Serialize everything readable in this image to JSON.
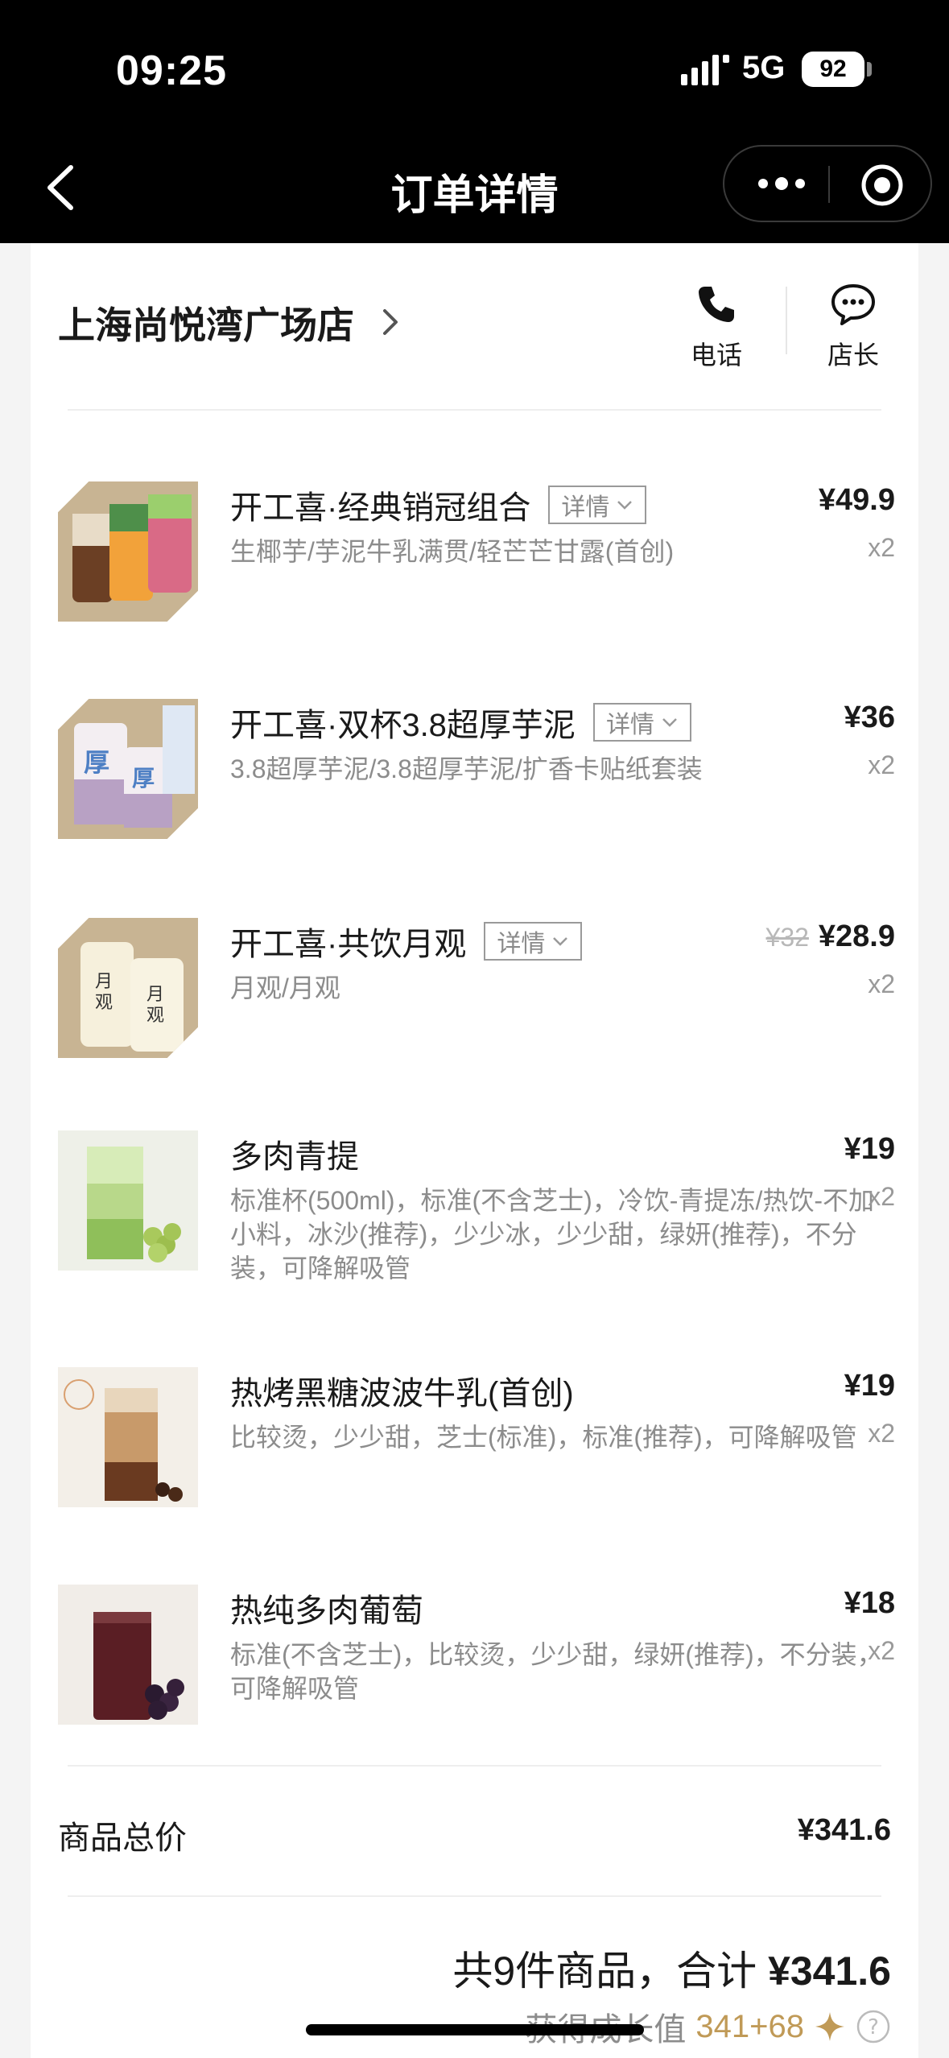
{
  "status_bar": {
    "time": "09:25",
    "network": "5G",
    "battery": "92"
  },
  "nav": {
    "title": "订单详情"
  },
  "store": {
    "name": "上海尚悦湾广场店",
    "phone_label": "电话",
    "manager_label": "店长"
  },
  "items": [
    {
      "name": "开工喜·经典销冠组合",
      "detail": "详情",
      "desc": "生椰芋/芋泥牛乳满贯/轻芒芒甘露(首创)",
      "price": "¥49.9",
      "qty": "x2"
    },
    {
      "name": "开工喜·双杯3.8超厚芋泥",
      "detail": "详情",
      "desc": "3.8超厚芋泥/3.8超厚芋泥/扩香卡贴纸套装",
      "price": "¥36",
      "qty": "x2"
    },
    {
      "name": "开工喜·共饮月观",
      "detail": "详情",
      "desc": "月观/月观",
      "old_price": "¥32",
      "price": "¥28.9",
      "qty": "x2"
    },
    {
      "name": "多肉青提",
      "desc": "标准杯(500ml)，标准(不含芝士)，冷饮-青提冻/热饮-不加小料，冰沙(推荐)，少少冰，少少甜，绿妍(推荐)，不分装，可降解吸管",
      "price": "¥19",
      "qty": "x2"
    },
    {
      "name": "热烤黑糖波波牛乳(首创)",
      "desc": "比较烫，少少甜，芝士(标准)，标准(推荐)，可降解吸管",
      "price": "¥19",
      "qty": "x2"
    },
    {
      "name": "热纯多肉葡萄",
      "desc": "标准(不含芝士)，比较烫，少少甜，绿妍(推荐)，不分装，可降解吸管",
      "price": "¥18",
      "qty": "x2"
    }
  ],
  "totals": {
    "label": "商品总价",
    "value": "¥341.6",
    "summary_prefix": "共9件商品，合计",
    "summary_amount": "¥341.6",
    "growth_label": "获得成长值",
    "growth_value": "341+68"
  },
  "colors": {
    "accent_gold": "#c09a57",
    "header_bg": "#000000"
  }
}
